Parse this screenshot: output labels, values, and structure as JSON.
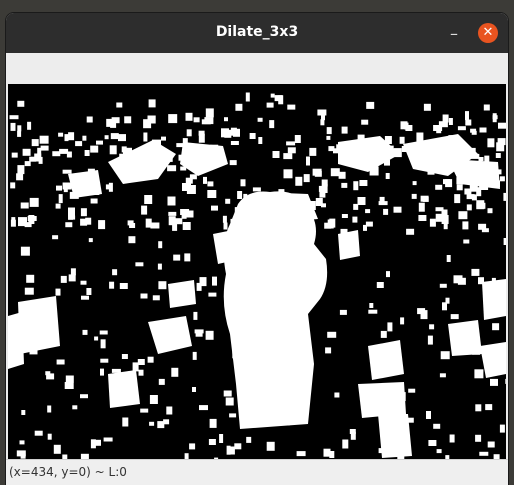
{
  "window": {
    "title": "Dilate_3x3",
    "minimize_glyph": "–",
    "close_glyph": "✕"
  },
  "colors": {
    "titlebar": "#2d2d2d",
    "close_button": "#e95420",
    "image_background": "#000000",
    "foreground": "#ffffff"
  },
  "image": {
    "description_icon": "binary-dilated-image"
  },
  "status": {
    "text": "(x=434, y=0) ~ L:0"
  }
}
